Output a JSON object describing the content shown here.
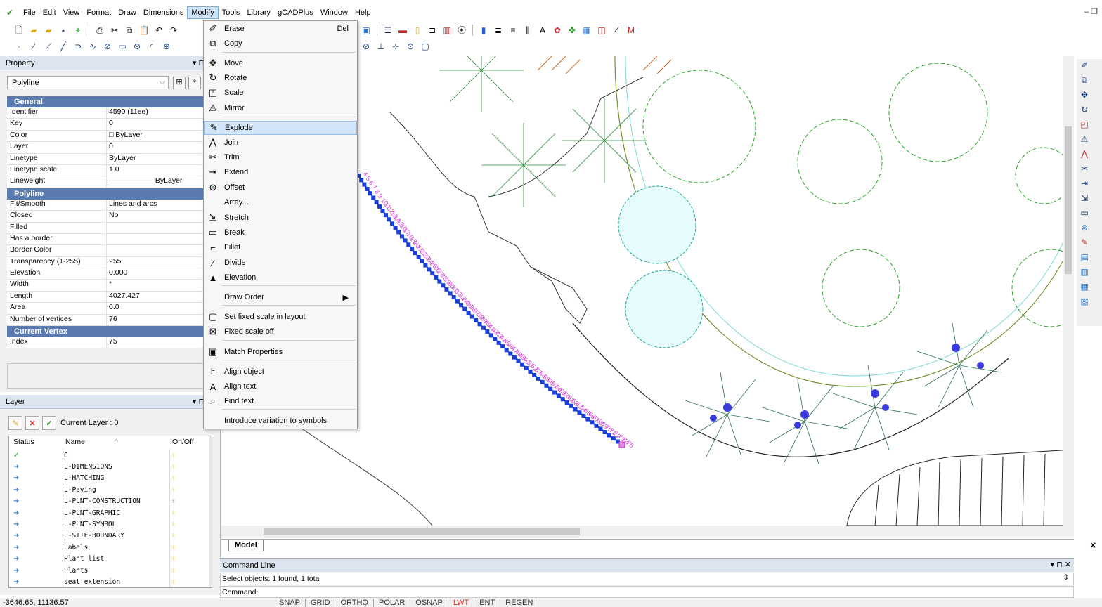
{
  "menubar": {
    "items": [
      "File",
      "Edit",
      "View",
      "Format",
      "Draw",
      "Dimensions",
      "Modify",
      "Tools",
      "Library",
      "gCADPlus",
      "Window",
      "Help"
    ],
    "active": "Modify",
    "window_controls": "–  ❐"
  },
  "property_panel": {
    "title": "Property",
    "selected_type": "Polyline",
    "general_header": "General",
    "general": [
      {
        "k": "Identifier",
        "v": "4590 (11ee)"
      },
      {
        "k": "Key",
        "v": "0"
      },
      {
        "k": "Color",
        "v": "□ ByLayer"
      },
      {
        "k": "Layer",
        "v": "0"
      },
      {
        "k": "Linetype",
        "v": "ByLayer"
      },
      {
        "k": "Linetype scale",
        "v": "1.0"
      },
      {
        "k": "Lineweight",
        "v": "——————  ByLayer"
      }
    ],
    "polyline_header": "Polyline",
    "polyline": [
      {
        "k": "Fit/Smooth",
        "v": "Lines and arcs"
      },
      {
        "k": "Closed",
        "v": "No"
      },
      {
        "k": "Filled",
        "v": ""
      },
      {
        "k": "Has a border",
        "v": ""
      },
      {
        "k": "Border Color",
        "v": ""
      },
      {
        "k": "Transparency (1-255)",
        "v": "255"
      },
      {
        "k": "Elevation",
        "v": "0.000"
      },
      {
        "k": "Width",
        "v": "*"
      },
      {
        "k": "Length",
        "v": "4027.427"
      },
      {
        "k": "Area",
        "v": "0.0"
      },
      {
        "k": "Number of vertices",
        "v": "76"
      }
    ],
    "vertex_header": "Current Vertex",
    "vertex": [
      {
        "k": "Index",
        "v": "75"
      }
    ]
  },
  "layer_panel": {
    "title": "Layer",
    "current_layer": "Current Layer : 0",
    "columns": [
      "Status",
      "Name",
      "On/Off"
    ],
    "layers": [
      "0",
      "L-DIMENSIONS",
      "L-HATCHING",
      "L-Paving",
      "L-PLNT-CONSTRUCTION",
      "L-PLNT-GRAPHIC",
      "L-PLNT-SYMBOL",
      "L-SITE-BOUNDARY",
      "Labels",
      "Plant list",
      "Plants",
      "seat extension"
    ]
  },
  "modify_menu": {
    "items": [
      {
        "icon": "✐",
        "label": "Erase",
        "shortcut": "Del"
      },
      {
        "icon": "⧉",
        "label": "Copy",
        "shortcut": ""
      },
      {
        "icon": "✥",
        "label": "Move",
        "shortcut": ""
      },
      {
        "icon": "↻",
        "label": "Rotate",
        "shortcut": ""
      },
      {
        "icon": "◰",
        "label": "Scale",
        "shortcut": ""
      },
      {
        "icon": "⚠",
        "label": "Mirror",
        "shortcut": ""
      },
      {
        "icon": "✎",
        "label": "Explode",
        "shortcut": ""
      },
      {
        "icon": "⋀",
        "label": "Join",
        "shortcut": ""
      },
      {
        "icon": "✂",
        "label": "Trim",
        "shortcut": ""
      },
      {
        "icon": "⇥",
        "label": "Extend",
        "shortcut": ""
      },
      {
        "icon": "⊜",
        "label": "Offset",
        "shortcut": ""
      },
      {
        "icon": "",
        "label": "Array...",
        "shortcut": ""
      },
      {
        "icon": "⇲",
        "label": "Stretch",
        "shortcut": ""
      },
      {
        "icon": "▭",
        "label": "Break",
        "shortcut": ""
      },
      {
        "icon": "⌐",
        "label": "Fillet",
        "shortcut": ""
      },
      {
        "icon": "⁄",
        "label": "Divide",
        "shortcut": ""
      },
      {
        "icon": "▲",
        "label": "Elevation",
        "shortcut": ""
      },
      {
        "icon": "",
        "label": "Draw Order",
        "shortcut": "▶"
      },
      {
        "icon": "▢",
        "label": "Set fixed scale in layout",
        "shortcut": ""
      },
      {
        "icon": "⊠",
        "label": "Fixed scale off",
        "shortcut": ""
      },
      {
        "icon": "▣",
        "label": "Match Properties",
        "shortcut": ""
      },
      {
        "icon": "⊧",
        "label": "Align object",
        "shortcut": ""
      },
      {
        "icon": "A",
        "label": "Align text",
        "shortcut": ""
      },
      {
        "icon": "⌕",
        "label": "Find text",
        "shortcut": ""
      },
      {
        "icon": "",
        "label": "Introduce variation to symbols",
        "shortcut": ""
      }
    ],
    "highlighted": "Explode"
  },
  "drawing": {
    "tab": "Model",
    "numbers": [
      "4",
      "5",
      "6",
      "7",
      "8",
      "9",
      "10",
      "11",
      "12",
      "13",
      "14",
      "15",
      "16",
      "17",
      "18",
      "19",
      "20",
      "21",
      "22",
      "23",
      "24",
      "25",
      "26",
      "27",
      "28",
      "29",
      "30",
      "31",
      "32",
      "33",
      "34",
      "35",
      "36",
      "37",
      "38",
      "39",
      "40",
      "41",
      "42",
      "43",
      "44",
      "45",
      "46",
      "47",
      "48",
      "49",
      "50",
      "51",
      "52",
      "53",
      "54",
      "55",
      "56",
      "57",
      "58",
      "59",
      "60",
      "61",
      "62",
      "63",
      "64",
      "65",
      "66",
      "67",
      "68",
      "69",
      "70",
      "71",
      "72",
      "73",
      "74",
      "75"
    ]
  },
  "command": {
    "title": "Command Line",
    "line1": "Select objects: 1 found,  1 total",
    "line2": "Command:"
  },
  "status": {
    "coords": "-3646.65,  11136.57",
    "buttons": [
      "SNAP",
      "GRID",
      "ORTHO",
      "POLAR",
      "OSNAP",
      "LWT",
      "ENT",
      "REGEN"
    ],
    "lwt_color": "#e0312a"
  }
}
